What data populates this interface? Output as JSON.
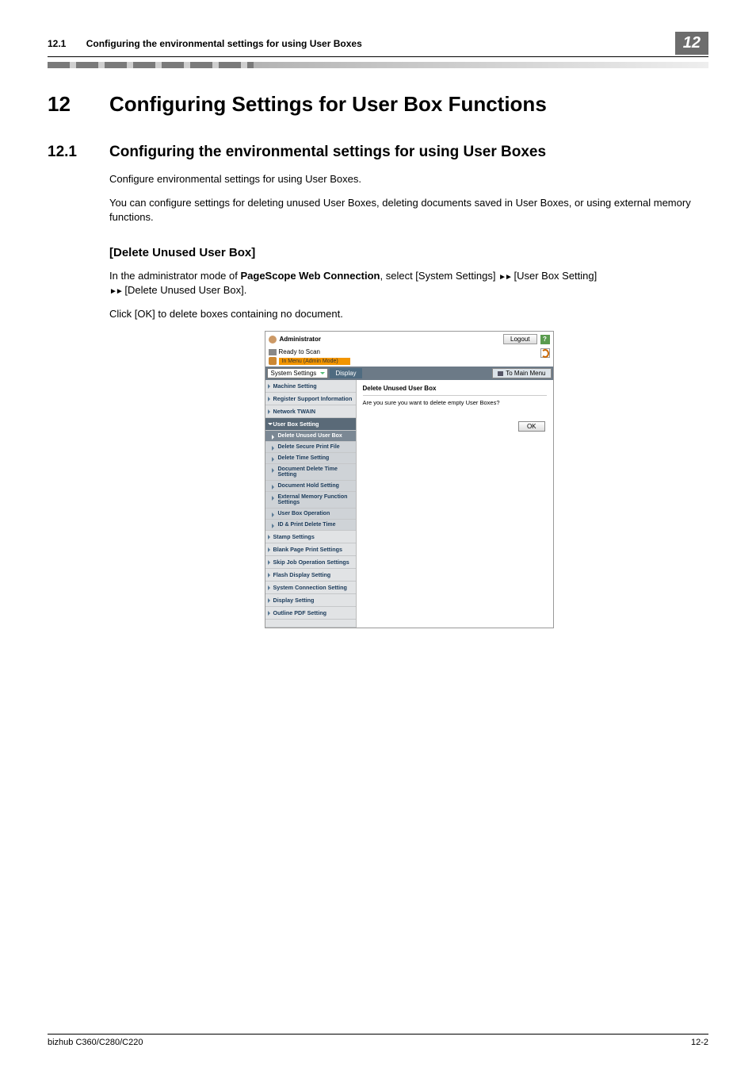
{
  "header": {
    "section_number": "12.1",
    "section_title": "Configuring the environmental settings for using User Boxes",
    "badge": "12"
  },
  "chapter": {
    "number": "12",
    "title": "Configuring Settings for User Box Functions"
  },
  "section": {
    "number": "12.1",
    "title": "Configuring the environmental settings for using User Boxes"
  },
  "para1": "Configure environmental settings for using User Boxes.",
  "para2": "You can configure settings for deleting unused User Boxes, deleting documents saved in User Boxes, or using external memory functions.",
  "subhead": "[Delete Unused User Box]",
  "para3_a": "In the administrator mode of ",
  "para3_b": "PageScope Web Connection",
  "para3_c": ", select [System Settings] ",
  "para3_d": " [User Box Setting] ",
  "para3_e": " [Delete Unused User Box].",
  "para4": "Click [OK] to delete boxes containing no document.",
  "screenshot": {
    "admin_label": "Administrator",
    "logout": "Logout",
    "help": "?",
    "ready": "Ready to Scan",
    "mode": "In Menu (Admin Mode)",
    "dropdown": "System Settings",
    "display_btn": "Display",
    "to_main": "To Main Menu",
    "sidebar_top": [
      "Machine Setting",
      "Register Support Information",
      "Network TWAIN"
    ],
    "sidebar_expanded": "User Box Setting",
    "sidebar_subs": [
      "Delete Unused User Box",
      "Delete Secure Print File",
      "Delete Time Setting",
      "Document Delete Time Setting",
      "Document Hold Setting",
      "External Memory Function Settings",
      "User Box Operation",
      "ID & Print Delete Time"
    ],
    "sidebar_bottom": [
      "Stamp Settings",
      "Blank Page Print Settings",
      "Skip Job Operation Settings",
      "Flash Display Setting",
      "System Connection Setting",
      "Display Setting",
      "Outline PDF Setting"
    ],
    "content_title": "Delete Unused User Box",
    "content_text": "Are you sure you want to delete empty User Boxes?",
    "ok": "OK"
  },
  "footer": {
    "left": "bizhub C360/C280/C220",
    "right": "12-2"
  }
}
